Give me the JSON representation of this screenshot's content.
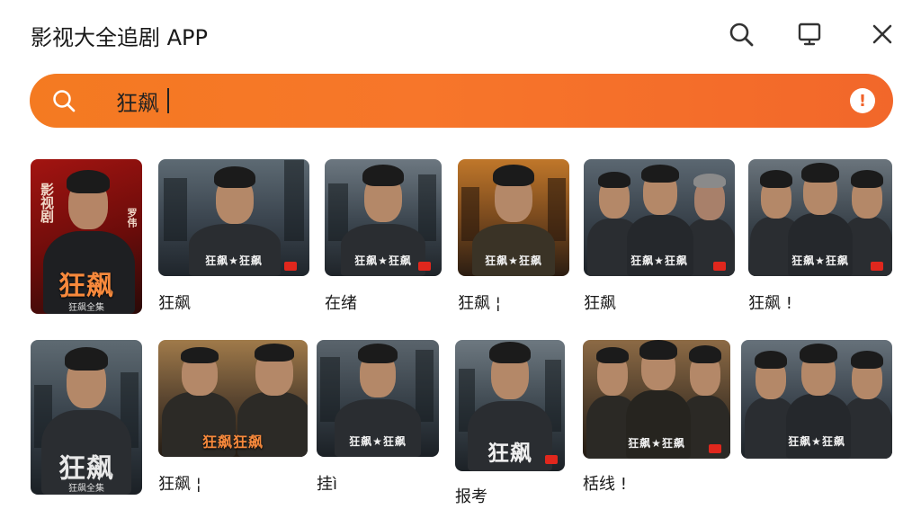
{
  "app": {
    "title": "影视大全追剧 APP"
  },
  "toolbar": {
    "icons": [
      "search-icon",
      "tv-icon",
      "close-icon"
    ]
  },
  "search": {
    "value": "狂飙",
    "placeholder": ""
  },
  "colors": {
    "accent": "#f47a21",
    "accent_end": "#f2672a",
    "text": "#1a1a1a"
  },
  "row1": [
    {
      "label": "",
      "poster_title": "狂飙",
      "poster_sub": "狂飙全集",
      "side_text": "影视剧",
      "side_right": "罗伟"
    },
    {
      "label": "狂飙",
      "poster_title": "狂飙★狂飙",
      "poster_sub": ""
    },
    {
      "label": "在绪",
      "poster_title": "狂飙★狂飙",
      "poster_sub": ""
    },
    {
      "label": "狂飙 ¦",
      "poster_title": "狂飙★狂飙",
      "poster_sub": ""
    },
    {
      "label": "狂飙",
      "poster_title": "狂飙★狂飙",
      "poster_sub": ""
    },
    {
      "label": "狂飙 !",
      "poster_title": "狂飙★狂飙",
      "poster_sub": ""
    }
  ],
  "row2": [
    {
      "label": "",
      "poster_title": "狂飙",
      "poster_sub": "狂飙全集"
    },
    {
      "label": "狂飙 ¦",
      "poster_title": "狂飙狂飙",
      "poster_sub": ""
    },
    {
      "label": "挂ì",
      "poster_title": "狂飙★狂飙",
      "poster_sub": ""
    },
    {
      "label": "报考",
      "poster_title": "狂飙",
      "poster_sub": ""
    },
    {
      "label": "栝线 !",
      "poster_title": "狂飙★狂飙",
      "poster_sub": ""
    },
    {
      "label": "",
      "poster_title": "狂飙★狂飙",
      "poster_sub": ""
    }
  ]
}
